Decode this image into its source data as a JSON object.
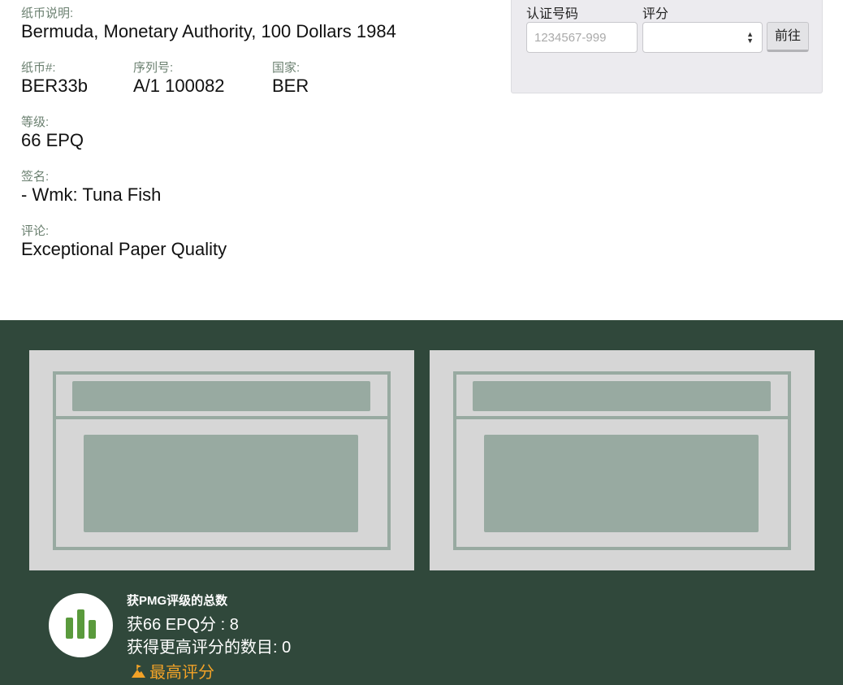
{
  "details": {
    "description": {
      "label": "纸币说明:",
      "value": "Bermuda, Monetary Authority, 100 Dollars 1984"
    },
    "note_number": {
      "label": "纸币#:",
      "value": "BER33b"
    },
    "serial": {
      "label": "序列号:",
      "value": "A/1 100082"
    },
    "country": {
      "label": "国家:",
      "value": "BER"
    },
    "grade": {
      "label": "等级:",
      "value": "66 EPQ"
    },
    "signatures": {
      "label": "签名:",
      "value": "- Wmk: Tuna Fish"
    },
    "comments": {
      "label": "评论:",
      "value": "Exceptional Paper Quality"
    }
  },
  "lookup": {
    "cert_label": "认证号码",
    "cert_placeholder": "1234567-999",
    "grade_label": "评分",
    "grade_value": "",
    "go_label": "前往"
  },
  "population": {
    "title": "获PMG评级的总数",
    "graded_at_grade": "获66 EPQ分 : 8",
    "graded_higher": "获得更高评分的数目: 0",
    "top_pop_label": "最高评分"
  },
  "colors": {
    "band": "#30483b",
    "placeholder_bg": "#d6d6d6",
    "placeholder_fg": "#98aaa1",
    "accent_orange": "#f2a227",
    "icon_green": "#5a9a3c"
  },
  "icons": {
    "population": "bar-chart-icon",
    "top_pop": "mountain-flag-icon"
  }
}
